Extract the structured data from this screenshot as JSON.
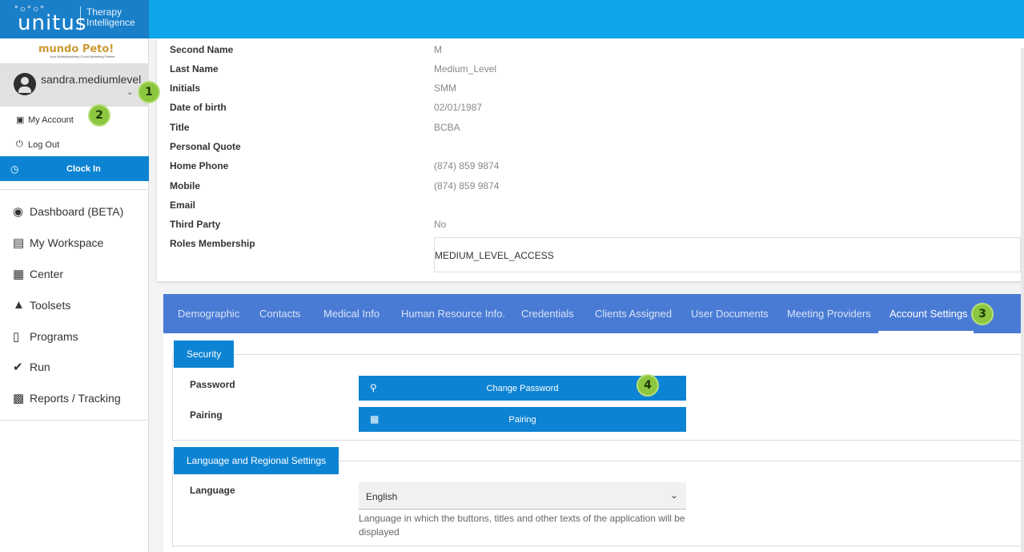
{
  "brand": {
    "logo": "unitus",
    "tagline_1": "Therapy",
    "tagline_2": "Intelligence"
  },
  "sidebar": {
    "partner": "mundo Peto!",
    "partner_sub": "Your Multidisciplinary Cloud Marketing Partner",
    "username": "sandra.mediumlevel",
    "my_account": "My Account",
    "log_out": "Log Out",
    "clock_in": "Clock In",
    "nav": [
      {
        "label": "Dashboard (BETA)",
        "icon": "dashboard-icon"
      },
      {
        "label": "My Workspace",
        "icon": "briefcase-icon"
      },
      {
        "label": "Center",
        "icon": "building-icon"
      },
      {
        "label": "Toolsets",
        "icon": "puzzle-icon"
      },
      {
        "label": "Programs",
        "icon": "clipboard-icon"
      },
      {
        "label": "Run",
        "icon": "check-circle-icon"
      },
      {
        "label": "Reports / Tracking",
        "icon": "chart-icon"
      }
    ]
  },
  "badges": [
    "1",
    "2",
    "3",
    "4"
  ],
  "profile": {
    "rows": [
      {
        "label": "Second Name",
        "value": "M"
      },
      {
        "label": "Last Name",
        "value": "Medium_Level"
      },
      {
        "label": "Initials",
        "value": "SMM"
      },
      {
        "label": "Date of birth",
        "value": "02/01/1987"
      },
      {
        "label": "Title",
        "value": "BCBA"
      },
      {
        "label": "Personal Quote",
        "value": ""
      },
      {
        "label": "Home Phone",
        "value": "(874) 859 9874"
      },
      {
        "label": "Mobile",
        "value": "(874) 859 9874"
      },
      {
        "label": "Email",
        "value": ""
      },
      {
        "label": "Third Party",
        "value": "No"
      },
      {
        "label": "Roles Membership",
        "value": ""
      }
    ],
    "roles": "MEDIUM_LEVEL_ACCESS"
  },
  "tabs": [
    "Demographic",
    "Contacts",
    "Medical Info",
    "Human Resource Info.",
    "Credentials",
    "Clients Assigned",
    "User Documents",
    "Meeting Providers",
    "Account Settings"
  ],
  "security": {
    "title": "Security",
    "password_label": "Password",
    "change_password": "Change Password",
    "pairing_label": "Pairing",
    "pairing_button": "Pairing"
  },
  "language_section": {
    "title": "Language and Regional Settings",
    "label": "Language",
    "selected": "English",
    "help": "Language in which the buttons, titles and other texts of the application will be displayed"
  },
  "colors": {
    "topbar": "#0ea5e9",
    "brand": "#1a7fc9",
    "primary": "#0d83d3",
    "tabbar": "#4a7bd4",
    "badge": "#8dc63f"
  }
}
